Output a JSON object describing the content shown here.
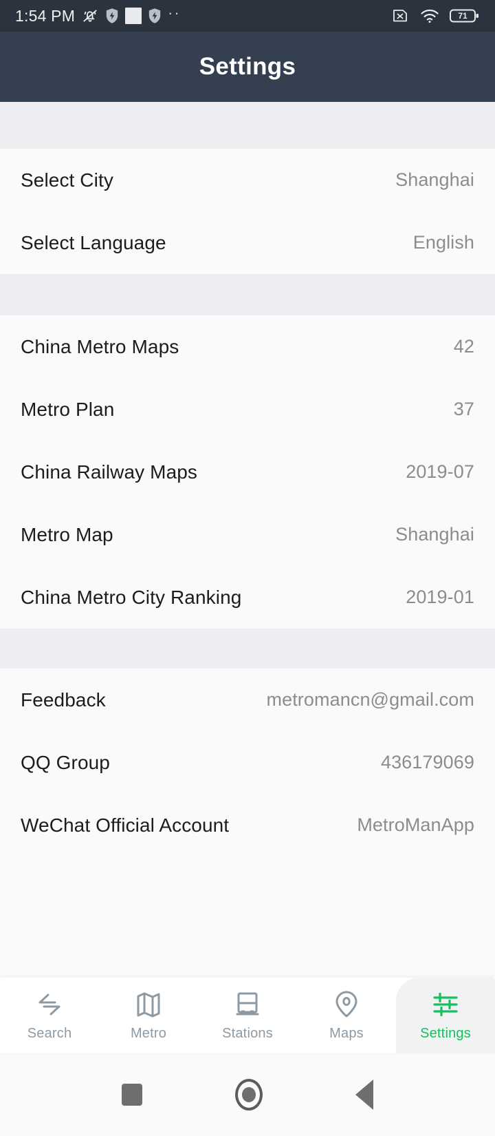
{
  "statusbar": {
    "time": "1:54 PM",
    "left_icons": [
      "bell-muted-icon",
      "shield-bolt-icon",
      "white-square-icon",
      "shield-bolt-icon",
      "more-dots-icon"
    ],
    "right_icons": [
      "no-sim-icon",
      "wifi-icon",
      "battery-icon"
    ],
    "battery_level": "71"
  },
  "appbar": {
    "title": "Settings"
  },
  "groups": [
    {
      "rows": [
        {
          "label": "Select City",
          "value": "Shanghai"
        },
        {
          "label": "Select Language",
          "value": "English"
        }
      ]
    },
    {
      "rows": [
        {
          "label": "China Metro Maps",
          "value": "42"
        },
        {
          "label": "Metro Plan",
          "value": "37"
        },
        {
          "label": "China Railway Maps",
          "value": "2019-07"
        },
        {
          "label": "Metro Map",
          "value": "Shanghai"
        },
        {
          "label": "China Metro City Ranking",
          "value": "2019-01"
        }
      ]
    },
    {
      "rows": [
        {
          "label": "Feedback",
          "value": "metromancn@gmail.com"
        },
        {
          "label": "QQ Group",
          "value": "436179069"
        },
        {
          "label": "WeChat Official Account",
          "value": "MetroManApp"
        }
      ]
    }
  ],
  "tabbar": {
    "active_color": "#18bf5e",
    "inactive_color": "#8e9aa3",
    "tabs": [
      {
        "label": "Search",
        "icon": "route-transfer-icon",
        "active": false
      },
      {
        "label": "Metro",
        "icon": "folded-map-icon",
        "active": false
      },
      {
        "label": "Stations",
        "icon": "train-station-icon",
        "active": false
      },
      {
        "label": "Maps",
        "icon": "location-pin-icon",
        "active": false
      },
      {
        "label": "Settings",
        "icon": "sliders-icon",
        "active": true
      }
    ]
  },
  "navbar": {
    "buttons": [
      {
        "icon": "recents-square-icon"
      },
      {
        "icon": "home-circle-icon"
      },
      {
        "icon": "back-triangle-icon"
      }
    ]
  }
}
